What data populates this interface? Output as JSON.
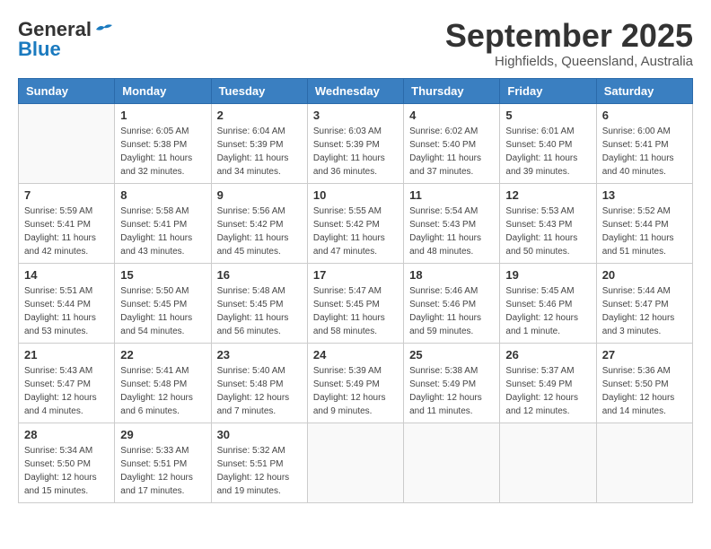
{
  "logo": {
    "general": "General",
    "blue": "Blue"
  },
  "title": "September 2025",
  "subtitle": "Highfields, Queensland, Australia",
  "headers": [
    "Sunday",
    "Monday",
    "Tuesday",
    "Wednesday",
    "Thursday",
    "Friday",
    "Saturday"
  ],
  "weeks": [
    [
      {
        "day": "",
        "info": ""
      },
      {
        "day": "1",
        "info": "Sunrise: 6:05 AM\nSunset: 5:38 PM\nDaylight: 11 hours\nand 32 minutes."
      },
      {
        "day": "2",
        "info": "Sunrise: 6:04 AM\nSunset: 5:39 PM\nDaylight: 11 hours\nand 34 minutes."
      },
      {
        "day": "3",
        "info": "Sunrise: 6:03 AM\nSunset: 5:39 PM\nDaylight: 11 hours\nand 36 minutes."
      },
      {
        "day": "4",
        "info": "Sunrise: 6:02 AM\nSunset: 5:40 PM\nDaylight: 11 hours\nand 37 minutes."
      },
      {
        "day": "5",
        "info": "Sunrise: 6:01 AM\nSunset: 5:40 PM\nDaylight: 11 hours\nand 39 minutes."
      },
      {
        "day": "6",
        "info": "Sunrise: 6:00 AM\nSunset: 5:41 PM\nDaylight: 11 hours\nand 40 minutes."
      }
    ],
    [
      {
        "day": "7",
        "info": "Sunrise: 5:59 AM\nSunset: 5:41 PM\nDaylight: 11 hours\nand 42 minutes."
      },
      {
        "day": "8",
        "info": "Sunrise: 5:58 AM\nSunset: 5:41 PM\nDaylight: 11 hours\nand 43 minutes."
      },
      {
        "day": "9",
        "info": "Sunrise: 5:56 AM\nSunset: 5:42 PM\nDaylight: 11 hours\nand 45 minutes."
      },
      {
        "day": "10",
        "info": "Sunrise: 5:55 AM\nSunset: 5:42 PM\nDaylight: 11 hours\nand 47 minutes."
      },
      {
        "day": "11",
        "info": "Sunrise: 5:54 AM\nSunset: 5:43 PM\nDaylight: 11 hours\nand 48 minutes."
      },
      {
        "day": "12",
        "info": "Sunrise: 5:53 AM\nSunset: 5:43 PM\nDaylight: 11 hours\nand 50 minutes."
      },
      {
        "day": "13",
        "info": "Sunrise: 5:52 AM\nSunset: 5:44 PM\nDaylight: 11 hours\nand 51 minutes."
      }
    ],
    [
      {
        "day": "14",
        "info": "Sunrise: 5:51 AM\nSunset: 5:44 PM\nDaylight: 11 hours\nand 53 minutes."
      },
      {
        "day": "15",
        "info": "Sunrise: 5:50 AM\nSunset: 5:45 PM\nDaylight: 11 hours\nand 54 minutes."
      },
      {
        "day": "16",
        "info": "Sunrise: 5:48 AM\nSunset: 5:45 PM\nDaylight: 11 hours\nand 56 minutes."
      },
      {
        "day": "17",
        "info": "Sunrise: 5:47 AM\nSunset: 5:45 PM\nDaylight: 11 hours\nand 58 minutes."
      },
      {
        "day": "18",
        "info": "Sunrise: 5:46 AM\nSunset: 5:46 PM\nDaylight: 11 hours\nand 59 minutes."
      },
      {
        "day": "19",
        "info": "Sunrise: 5:45 AM\nSunset: 5:46 PM\nDaylight: 12 hours\nand 1 minute."
      },
      {
        "day": "20",
        "info": "Sunrise: 5:44 AM\nSunset: 5:47 PM\nDaylight: 12 hours\nand 3 minutes."
      }
    ],
    [
      {
        "day": "21",
        "info": "Sunrise: 5:43 AM\nSunset: 5:47 PM\nDaylight: 12 hours\nand 4 minutes."
      },
      {
        "day": "22",
        "info": "Sunrise: 5:41 AM\nSunset: 5:48 PM\nDaylight: 12 hours\nand 6 minutes."
      },
      {
        "day": "23",
        "info": "Sunrise: 5:40 AM\nSunset: 5:48 PM\nDaylight: 12 hours\nand 7 minutes."
      },
      {
        "day": "24",
        "info": "Sunrise: 5:39 AM\nSunset: 5:49 PM\nDaylight: 12 hours\nand 9 minutes."
      },
      {
        "day": "25",
        "info": "Sunrise: 5:38 AM\nSunset: 5:49 PM\nDaylight: 12 hours\nand 11 minutes."
      },
      {
        "day": "26",
        "info": "Sunrise: 5:37 AM\nSunset: 5:49 PM\nDaylight: 12 hours\nand 12 minutes."
      },
      {
        "day": "27",
        "info": "Sunrise: 5:36 AM\nSunset: 5:50 PM\nDaylight: 12 hours\nand 14 minutes."
      }
    ],
    [
      {
        "day": "28",
        "info": "Sunrise: 5:34 AM\nSunset: 5:50 PM\nDaylight: 12 hours\nand 15 minutes."
      },
      {
        "day": "29",
        "info": "Sunrise: 5:33 AM\nSunset: 5:51 PM\nDaylight: 12 hours\nand 17 minutes."
      },
      {
        "day": "30",
        "info": "Sunrise: 5:32 AM\nSunset: 5:51 PM\nDaylight: 12 hours\nand 19 minutes."
      },
      {
        "day": "",
        "info": ""
      },
      {
        "day": "",
        "info": ""
      },
      {
        "day": "",
        "info": ""
      },
      {
        "day": "",
        "info": ""
      }
    ]
  ]
}
